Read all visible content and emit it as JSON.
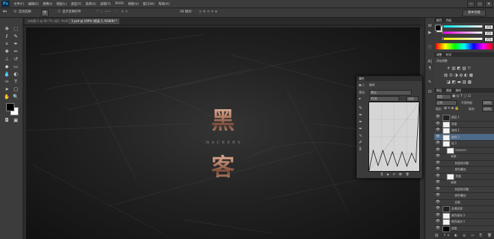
{
  "app": {
    "logo": "Ps"
  },
  "menu": [
    "文件(F)",
    "编辑(E)",
    "图像(I)",
    "图层(L)",
    "类型(Y)",
    "选择(S)",
    "滤镜(T)",
    "3D(D)",
    "视图(V)",
    "窗口(W)",
    "帮助(H)"
  ],
  "window_controls": [
    "—",
    "▭",
    "✕"
  ],
  "options": {
    "auto_select": "自动选择:",
    "group": "组",
    "show_transform": "显示变换控件",
    "mode_3d": "3D 模式:",
    "workspace": "基本功能"
  },
  "tabs": [
    {
      "label": "未标题-1 @ 66.7% (组1, RGB/8) ×",
      "active": false
    },
    {
      "label": "1.psd @ 100% (图层 1, RGB/8) *",
      "active": true
    }
  ],
  "canvas": {
    "char1": "黑",
    "char2": "客",
    "subtitle": "HACKERS"
  },
  "curves": {
    "title": "属性",
    "adjust_label": "曲线",
    "preset_label": "预设:",
    "preset_value": "默认",
    "channel_value": "RGB",
    "auto_label": "自动"
  },
  "color_panel": {
    "tabs": [
      "颜色",
      "色板"
    ],
    "r_label": "R",
    "g_label": "G",
    "b_label": "B",
    "r": "255",
    "g": "255",
    "b": "255"
  },
  "adjust_panel": {
    "tabs": [
      "调整",
      "样式"
    ],
    "add_label": "添加调整"
  },
  "layers_panel": {
    "tabs": [
      "图层",
      "通道",
      "路径"
    ],
    "kind": "类型",
    "blend": "正常",
    "opacity_label": "不透明度:",
    "opacity": "100%",
    "lock_label": "锁定:",
    "fill_label": "填充:",
    "fill": "100%",
    "layers": [
      {
        "name": "图层 1",
        "selected": false,
        "indent": 0
      },
      {
        "name": "黑客 ",
        "selected": false,
        "indent": 0
      },
      {
        "name": "曲线 1",
        "selected": false,
        "indent": 0
      },
      {
        "name": "曲线 2",
        "selected": true,
        "indent": 0
      },
      {
        "name": "组 1",
        "selected": false,
        "indent": 0
      },
      {
        "name": "hackers",
        "selected": false,
        "indent": 1
      },
      {
        "name": "效果",
        "selected": false,
        "indent": 2
      },
      {
        "name": "斜面和浮雕",
        "selected": false,
        "indent": 3
      },
      {
        "name": "颜色叠加",
        "selected": false,
        "indent": 3
      },
      {
        "name": "黑客",
        "selected": false,
        "indent": 1
      },
      {
        "name": "效果",
        "selected": false,
        "indent": 2
      },
      {
        "name": "斜面和浮雕",
        "selected": false,
        "indent": 3
      },
      {
        "name": "颜色叠加",
        "selected": false,
        "indent": 3
      },
      {
        "name": "投影",
        "selected": false,
        "indent": 3
      },
      {
        "name": "金属纹理",
        "selected": false,
        "indent": 0
      },
      {
        "name": "颜色填充 2",
        "selected": false,
        "indent": 0
      },
      {
        "name": "颜色填充 1",
        "selected": false,
        "indent": 0
      },
      {
        "name": "背景",
        "selected": false,
        "indent": 0
      }
    ]
  },
  "colors": {
    "accent": "#31a8ff",
    "letter": "#c08a70",
    "selected_row": "#4d6a8a"
  }
}
